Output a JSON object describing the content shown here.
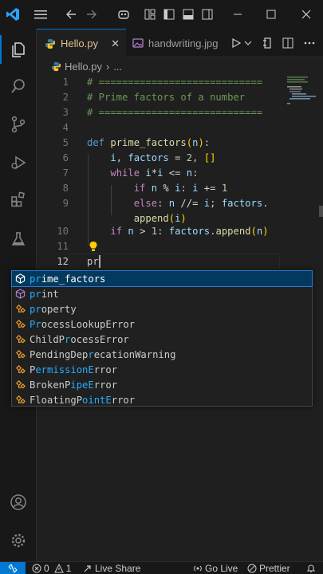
{
  "titlebar": {
    "icons": [
      "vscode-logo-icon",
      "menu-icon",
      "back-arrow-icon",
      "forward-arrow-icon",
      "copilot-icon",
      "layout-icon",
      "toggle-sidebar-icon",
      "toggle-panel-icon",
      "toggle-secondary-sidebar-icon",
      "minimize-icon",
      "maximize-icon",
      "close-icon"
    ]
  },
  "activitybar": {
    "items": [
      "explorer-icon",
      "search-icon",
      "source-control-icon",
      "run-debug-icon",
      "extensions-icon",
      "testing-icon",
      "accounts-icon",
      "manage-gear-icon"
    ]
  },
  "tabs": [
    {
      "label": "Hello.py",
      "active": true,
      "close": "✕"
    },
    {
      "label": "handwriting.jpg",
      "active": false
    }
  ],
  "tab_actions": [
    "run-python-icon",
    "run-dropdown-icon",
    "open-changes-icon",
    "split-editor-icon",
    "more-actions-icon"
  ],
  "breadcrumb": {
    "file": "Hello.py",
    "sep": "›",
    "ellipsis": "..."
  },
  "editor": {
    "line_numbers": [
      "1",
      "2",
      "3",
      "4",
      "5",
      "6",
      "7",
      "8",
      "9",
      "10",
      "11",
      "12"
    ],
    "lines": {
      "l1": "# ============================",
      "l2": "# Prime factors of a number",
      "l3": "# ============================",
      "l5_kw": "def",
      "l5_fn": "prime_factors",
      "l5_p1": "(",
      "l5_arg": "n",
      "l5_p2": ")",
      "l5_colon": ":",
      "l6_i": "i",
      "l6_comma": ", ",
      "l6_factors": "factors",
      "l6_eq": " = ",
      "l6_two": "2",
      "l6_comma2": ", ",
      "l6_br": "[]",
      "l7_kw": "while",
      "l7_i1": "i",
      "l7_op1": "*",
      "l7_i2": "i",
      "l7_op2": " <= ",
      "l7_n": "n",
      "l7_colon": ":",
      "l8_kw": "if",
      "l8_n": "n",
      "l8_op": " % ",
      "l8_i": "i",
      "l8_c": ": ",
      "l8_i2": "i",
      "l8_op2": " += ",
      "l8_one": "1",
      "l9_kw": "else",
      "l9_c": ": ",
      "l9_n": "n",
      "l9_op": " //= ",
      "l9_i": "i",
      "l9_semi": "; ",
      "l9_f": "factors",
      "l9_dot": ".",
      "l9b_fn": "append",
      "l9b_p1": "(",
      "l9b_i": "i",
      "l9b_p2": ")",
      "l10_kw": "if",
      "l10_n": "n",
      "l10_op": " > ",
      "l10_one": "1",
      "l10_c": ": ",
      "l10_f": "factors",
      "l10_dot": ".",
      "l10_fn": "append",
      "l10_p1": "(",
      "l10_arg": "n",
      "l10_p2": ")",
      "l12": "pr"
    }
  },
  "suggest": {
    "items": [
      {
        "match": "pr",
        "rest": "ime_factors",
        "kind": "cube"
      },
      {
        "match": "pr",
        "rest": "int",
        "kind": "cube"
      },
      {
        "match": "pr",
        "rest": "operty",
        "kind": "class"
      },
      {
        "pre": "",
        "match": "Pr",
        "rest": "ocessLookupError",
        "kind": "class"
      },
      {
        "pre": "ChildP",
        "match": "r",
        "rest": "ocessError",
        "kind": "class"
      },
      {
        "pre": "PendingDep",
        "match": "r",
        "rest": "ecationWarning",
        "kind": "class"
      },
      {
        "pre": "P",
        "match": "ermissionE",
        "rest": "rror",
        "kind": "class"
      },
      {
        "pre": "BrokenP",
        "match": "ipeE",
        "rest": "rror",
        "kind": "class"
      },
      {
        "pre": "FloatingP",
        "match": "ointE",
        "rest": "rror",
        "kind": "class"
      }
    ]
  },
  "statusbar": {
    "errors": "0",
    "warnings": "1",
    "live_share": "Live Share",
    "go_live": "Go Live",
    "prettier": "Prettier"
  },
  "colors": {
    "accent": "#0078d4",
    "tab_modified": "#e2c08d",
    "suggest_selected": "#04395e",
    "match": "#2aaaff"
  }
}
